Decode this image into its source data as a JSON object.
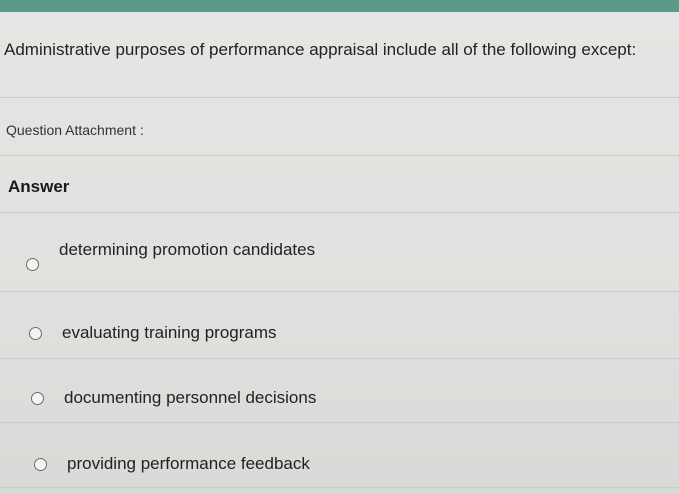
{
  "question": {
    "text": "Administrative purposes of performance appraisal include all of the following except:",
    "attachment_label": "Question Attachment :"
  },
  "answer": {
    "heading": "Answer",
    "options": [
      {
        "label": "determining promotion candidates",
        "selected": false
      },
      {
        "label": "evaluating training programs",
        "selected": false
      },
      {
        "label": "documenting personnel decisions",
        "selected": false
      },
      {
        "label": "providing performance feedback",
        "selected": false
      }
    ]
  },
  "colors": {
    "top_strip": "#5b9a88",
    "background": "#e0e2df",
    "divider": "#c9ccc8",
    "text": "#222222"
  }
}
